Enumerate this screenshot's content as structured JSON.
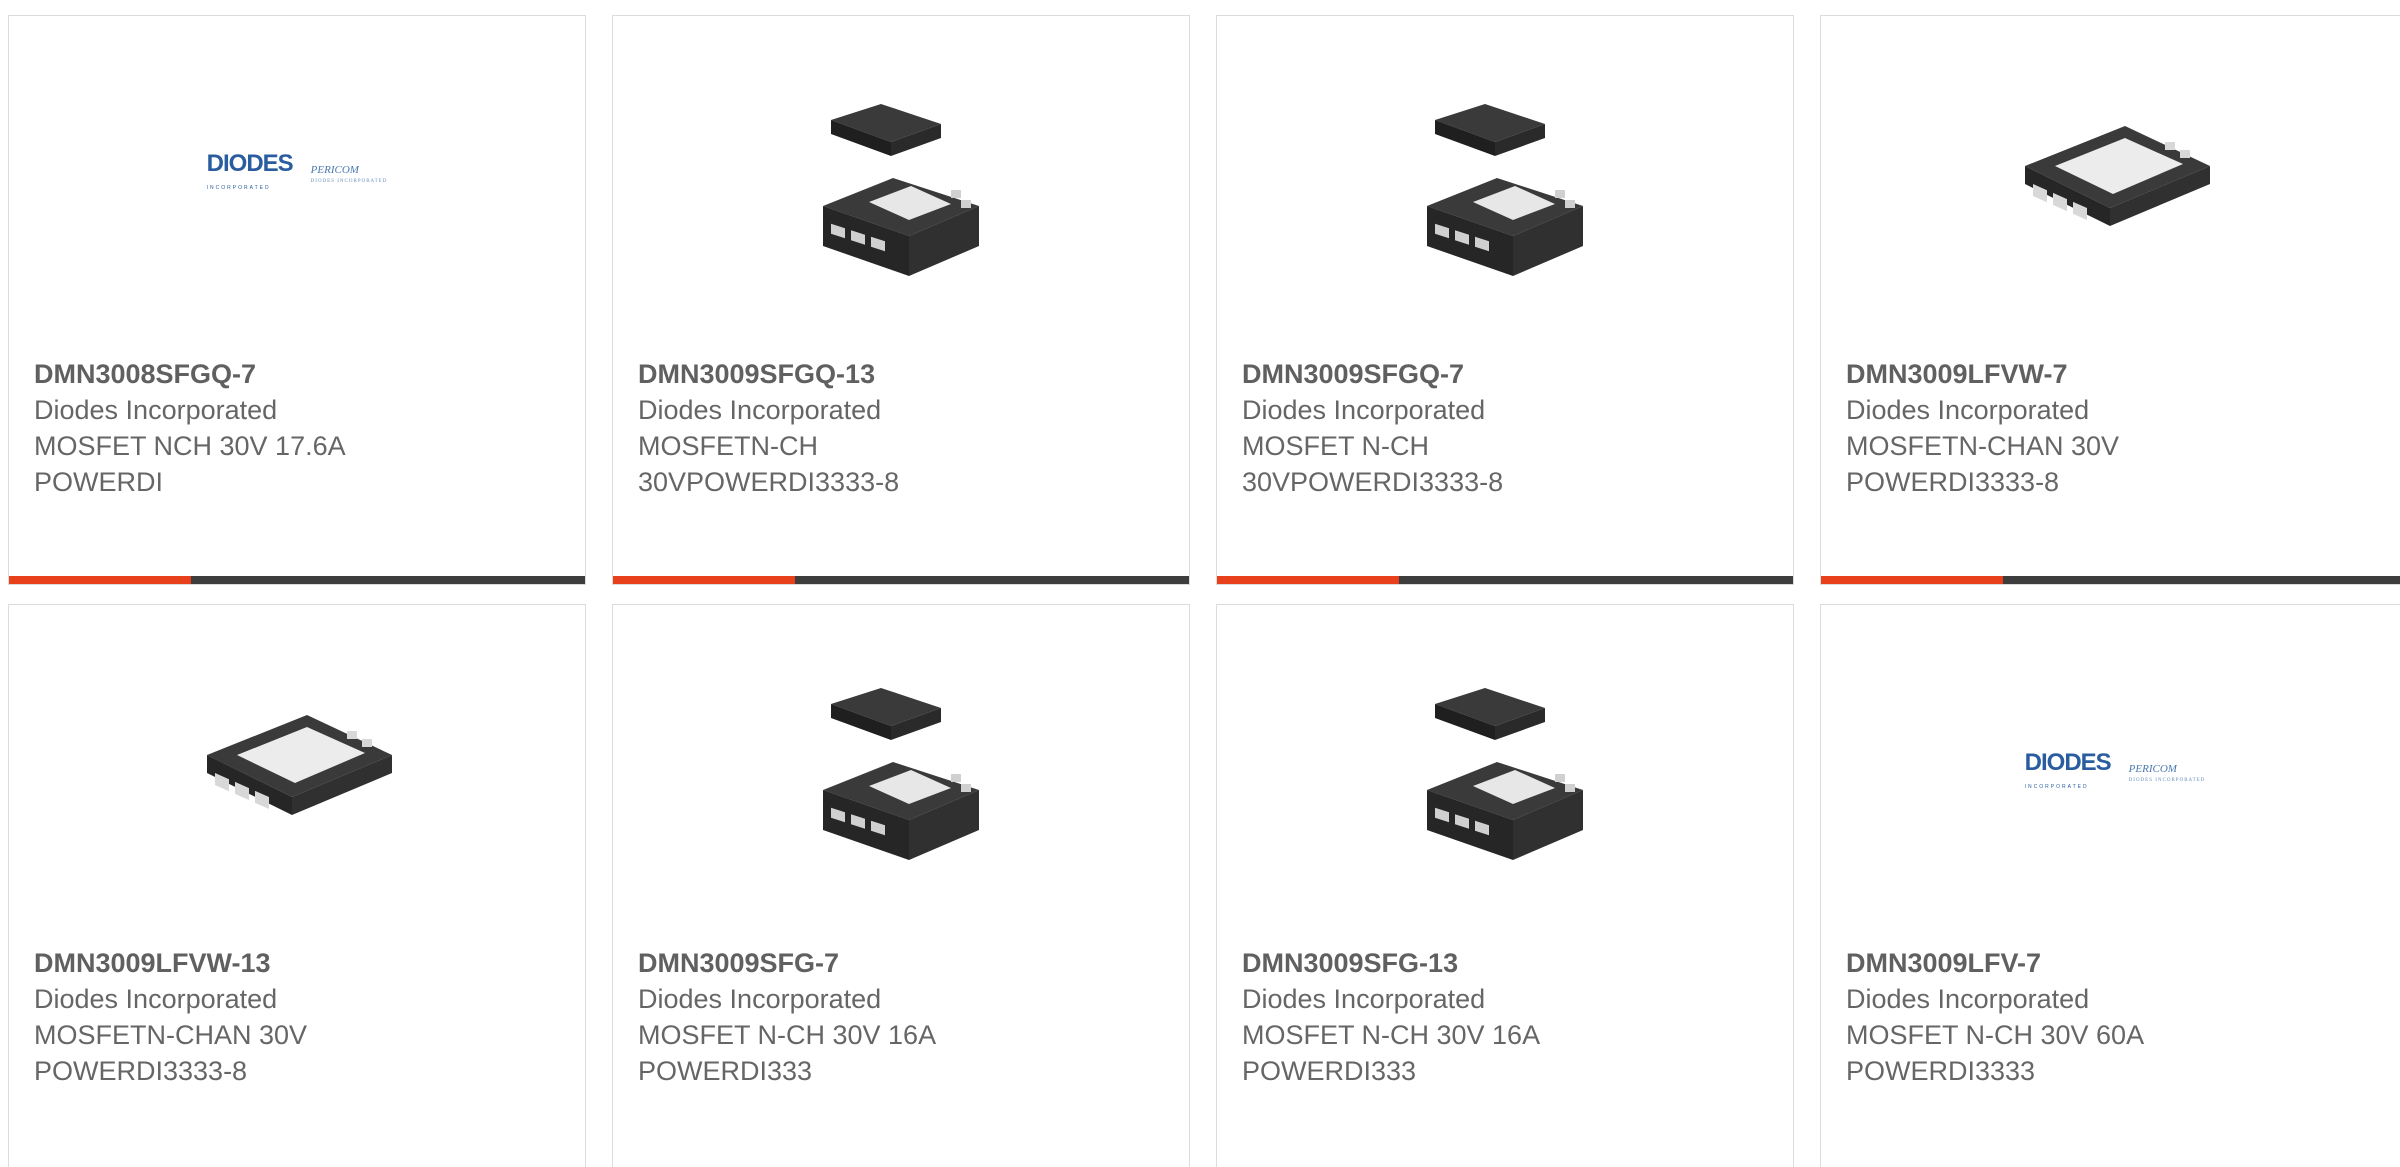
{
  "colors": {
    "accent": "#e8401a",
    "bar": "#3d3d3d",
    "border": "#dcdcdc",
    "title": "#606060",
    "text": "#666666",
    "logo_blue": "#2a5d9f"
  },
  "products": [
    {
      "part_number": "DMN3008SFGQ-7",
      "manufacturer": "Diodes Incorporated",
      "description": "MOSFET NCH 30V 17.6A POWERDI",
      "image": "diodes-pericom-logo"
    },
    {
      "part_number": "DMN3009SFGQ-13",
      "manufacturer": "Diodes Incorporated",
      "description": "MOSFETN-CH 30VPOWERDI3333-8",
      "image": "chip-package-exploded"
    },
    {
      "part_number": "DMN3009SFGQ-7",
      "manufacturer": "Diodes Incorporated",
      "description": "MOSFET N-CH 30VPOWERDI3333-8",
      "image": "chip-package-exploded"
    },
    {
      "part_number": "DMN3009LFVW-7",
      "manufacturer": "Diodes Incorporated",
      "description": "MOSFETN-CHAN 30V POWERDI3333-8",
      "image": "chip-package-flat"
    },
    {
      "part_number": "DMN3009LFVW-13",
      "manufacturer": "Diodes Incorporated",
      "description": "MOSFETN-CHAN 30V POWERDI3333-8",
      "image": "chip-package-flat"
    },
    {
      "part_number": "DMN3009SFG-7",
      "manufacturer": "Diodes Incorporated",
      "description": "MOSFET N-CH 30V 16A POWERDI333",
      "image": "chip-package-exploded"
    },
    {
      "part_number": "DMN3009SFG-13",
      "manufacturer": "Diodes Incorporated",
      "description": "MOSFET N-CH 30V 16A POWERDI333",
      "image": "chip-package-exploded"
    },
    {
      "part_number": "DMN3009LFV-7",
      "manufacturer": "Diodes Incorporated",
      "description": "MOSFET N-CH 30V 60A POWERDI3333",
      "image": "diodes-pericom-logo"
    }
  ],
  "logo": {
    "brand": "DIODES",
    "brand_sub": "INCORPORATED",
    "partner": "PERICOM",
    "partner_sub": "DIODES INCORPORATED"
  }
}
